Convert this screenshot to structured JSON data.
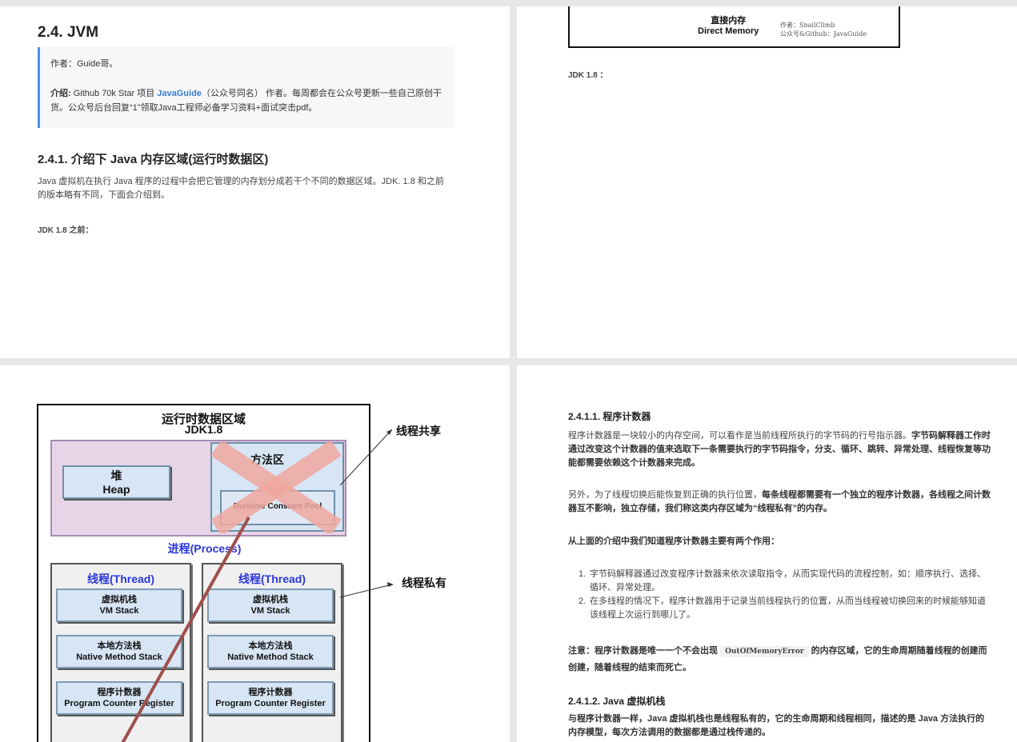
{
  "page1": {
    "section_title": "2.4. JVM",
    "author": "作者：Guide哥。",
    "intro_label": "介绍:",
    "intro_pre": " Github 70k Star 项目 ",
    "intro_link": "JavaGuide",
    "intro_post": "（公众号同名） 作者。每周都会在公众号更新一些自己原创干货。公众号后台回复“1”领取Java工程师必备学习资料+面试突击pdf。",
    "subsection_title": "2.4.1. 介绍下 Java 内存区域(运行时数据区)",
    "paragraph": "Java 虚拟机在执行 Java 程序的过程中会把它管理的内存划分成若干个不同的数据区域。JDK. 1.8 和之前的版本略有不同，下面会介绍到。",
    "jdk_before": "JDK 1.8 之前："
  },
  "page2": {
    "direct_memory_cn": "直接内存",
    "direct_memory_en": "Direct Memory",
    "credit_line1": "作者：SnailClimb",
    "credit_line2": "公众号&Github：JavaGuide",
    "jdk_label": "JDK 1.8 ："
  },
  "diagram": {
    "title": "运行时数据区域",
    "subtitle": "JDK1.8",
    "heap_cn": "堆",
    "heap_en": "Heap",
    "method_area_partial": "方法区",
    "runtime_pool_partial": "Runtime Constant Pool",
    "process_label": "进程(Process)",
    "threads": [
      {
        "label": "线程(Thread)",
        "vm_cn": "虚拟机栈",
        "vm_en": "VM Stack",
        "native_cn": "本地方法栈",
        "native_en": "Native Method Stack",
        "pc_cn": "程序计数器",
        "pc_en": "Program Counter Register"
      },
      {
        "label": "线程(Thread)",
        "vm_cn": "虚拟机栈",
        "vm_en": "VM Stack",
        "native_cn": "本地方法栈",
        "native_en": "Native Method Stack",
        "pc_cn": "程序计数器",
        "pc_en": "Program Counter Register"
      }
    ],
    "shared_label": "线程共享",
    "private_label": "线程私有"
  },
  "page4": {
    "pc_title": "2.4.1.1. 程序计数器",
    "pc_p1_a": "程序计数器是一块较小的内存空间，可以看作是当前线程所执行的字节码的行号指示器。",
    "pc_p1_b": "字节码解释器工作时通过改变这个计数器的值来选取下一条需要执行的字节码指令，分支、循环、跳转、异常处理、线程恢复等功能都需要依赖这个计数器来完成。",
    "pc_p2_a": "另外，为了线程切换后能恢复到正确的执行位置，",
    "pc_p2_b": "每条线程都需要有一个独立的程序计数器，各线程之间计数器互不影响，独立存储，我们称这类内存区域为“线程私有”的内存。",
    "pc_p3": "从上面的介绍中我们知道程序计数器主要有两个作用：",
    "list": [
      "字节码解释器通过改变程序计数器来依次读取指令，从而实现代码的流程控制，如：顺序执行、选择、循环、异常处理。",
      "在多线程的情况下，程序计数器用于记录当前线程执行的位置，从而当线程被切换回来的时候能够知道该线程上次运行到哪儿了。"
    ],
    "note_a": "注意：程序计数器是唯一一个不会出现 ",
    "note_code": "OutOfMemoryError",
    "note_b": " 的内存区域，它的生命周期随着线程的创建而创建，随着线程的结束而死亡。",
    "vm_title": "2.4.1.2. Java 虚拟机栈",
    "vm_p1": "与程序计数器一样，Java 虚拟机栈也是线程私有的，它的生命周期和线程相同，描述的是 Java 方法执行的内存模型，每次方法调用的数据都是通过栈传递的。"
  }
}
